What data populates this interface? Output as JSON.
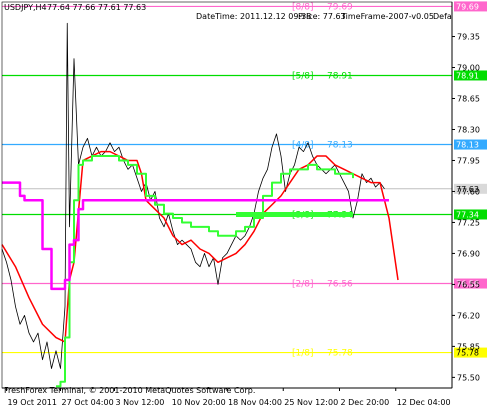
{
  "header": {
    "symbol": "USDJPY,H4",
    "ohlc": "77.64 77.66 77.61 77.63",
    "datetime": "DateTime: 2011.12.12 09:38",
    "price": "Price: 77.63",
    "timeframe": "TimeFrame-2007-v0.05",
    "defa": "Defa"
  },
  "footer": {
    "copyright": "FreshForex Terminal, © 2001-2010 MetaQuotes Software Corp."
  },
  "colors": {
    "background": "#ffffff",
    "axis": "#000000",
    "price_line": "#000000",
    "red_line": "#ff0000",
    "green_line": "#33ff33",
    "magenta_line": "#ff00ff",
    "level_pink": "#ff66cc",
    "level_green": "#00dd00",
    "level_blue": "#33aaff",
    "level_yellow": "#ffff00",
    "current_price": "#bfbfbf"
  },
  "chart_data": {
    "type": "line",
    "symbol": "USDJPY",
    "timeframe": "H4",
    "ylim": [
      75.38,
      79.74
    ],
    "xlim": [
      0,
      100
    ],
    "y_ticks": [
      "79.35",
      "79.00",
      "78.65",
      "78.30",
      "77.95",
      "77.60",
      "77.25",
      "76.90",
      "76.55",
      "76.20",
      "75.85",
      "75.50"
    ],
    "x_ticks": [
      {
        "label": "19 Oct 2011",
        "x": 1
      },
      {
        "label": "27 Oct 04:00",
        "x": 13
      },
      {
        "label": "3 Nov 12:00",
        "x": 25
      },
      {
        "label": "10 Nov 20:00",
        "x": 37.5
      },
      {
        "label": "18 Nov 04:00",
        "x": 50
      },
      {
        "label": "25 Nov 12:00",
        "x": 62.5
      },
      {
        "label": "2 Dec 20:00",
        "x": 75
      },
      {
        "label": "12 Dec 04:00",
        "x": 87.5
      }
    ],
    "levels": [
      {
        "name": "[8/8]",
        "label": "79.69",
        "value": 79.69,
        "tag": "79.69",
        "color": "#ff66cc"
      },
      {
        "name": "[5/8]",
        "label": "78.91",
        "value": 78.91,
        "tag": "78.91",
        "color": "#00dd00"
      },
      {
        "name": "[4/8]",
        "label": "78.13",
        "value": 78.13,
        "tag": "78.13",
        "color": "#33aaff"
      },
      {
        "name": "[3/8]",
        "label": "77.34",
        "value": 77.34,
        "tag": "77.34",
        "color": "#00dd00"
      },
      {
        "name": "[2/8]",
        "label": "76.56",
        "value": 76.56,
        "tag": "76.56",
        "color": "#ff66cc"
      },
      {
        "name": "[1/8]",
        "label": "75.78",
        "value": 75.78,
        "tag": "75.78",
        "color": "#ffff00"
      }
    ],
    "current_price": {
      "value": 77.63,
      "tag": "77.63"
    },
    "series": [
      {
        "name": "price",
        "x": [
          0,
          1,
          2,
          3,
          4,
          5,
          6,
          7,
          8,
          9,
          10,
          11,
          12,
          13,
          14,
          14.5,
          15,
          16,
          17,
          18,
          19,
          20,
          21,
          22,
          23,
          24,
          25,
          26,
          27,
          28,
          29,
          30,
          31,
          32,
          33,
          34,
          35,
          36,
          37,
          38,
          39,
          40,
          41,
          42,
          43,
          44,
          45,
          46,
          47,
          48,
          49,
          50,
          51,
          52,
          53,
          54,
          55,
          56,
          57,
          58,
          59,
          60,
          61,
          62,
          63,
          64,
          65,
          66,
          67,
          68,
          69,
          70,
          71,
          72,
          73,
          74,
          75,
          76,
          77,
          78,
          79,
          80,
          81,
          82,
          83,
          84,
          85
        ],
        "y": [
          76.95,
          76.8,
          76.6,
          76.3,
          76.1,
          76.2,
          76.0,
          75.9,
          76.0,
          75.7,
          75.9,
          75.6,
          75.8,
          75.6,
          76.3,
          79.5,
          77.2,
          79.1,
          77.9,
          78.1,
          78.2,
          78.0,
          78.1,
          78.0,
          78.05,
          78.15,
          78.05,
          78.1,
          77.95,
          77.85,
          77.9,
          77.75,
          77.6,
          77.7,
          77.5,
          77.6,
          77.3,
          77.2,
          77.35,
          77.15,
          77.0,
          77.05,
          77.0,
          76.95,
          76.8,
          76.75,
          76.9,
          76.75,
          76.85,
          76.55,
          76.85,
          76.9,
          77.0,
          77.1,
          77.05,
          77.1,
          77.2,
          77.35,
          77.6,
          77.75,
          77.85,
          78.1,
          78.25,
          78.0,
          77.6,
          77.8,
          77.9,
          78.1,
          78.05,
          78.15,
          78.0,
          77.9,
          77.85,
          77.8,
          77.85,
          77.9,
          77.8,
          77.7,
          77.6,
          77.3,
          77.5,
          77.8,
          77.7,
          77.75,
          77.65,
          77.7,
          77.63
        ]
      },
      {
        "name": "red",
        "x": [
          0,
          3,
          6,
          9,
          12,
          14,
          15,
          16,
          18,
          20,
          22,
          24,
          26,
          28,
          30,
          31,
          32,
          34,
          36,
          38,
          40,
          42,
          44,
          46,
          48,
          50,
          52,
          54,
          56,
          58,
          60,
          62,
          64,
          66,
          68,
          70,
          72,
          74,
          76,
          78,
          80,
          82,
          84,
          86,
          88
        ],
        "y": [
          77.0,
          76.75,
          76.4,
          76.1,
          75.95,
          75.9,
          76.6,
          76.8,
          77.95,
          78.0,
          78.05,
          78.05,
          78.0,
          77.95,
          77.95,
          77.8,
          77.5,
          77.4,
          77.3,
          77.1,
          77.0,
          77.05,
          76.95,
          76.9,
          76.8,
          76.85,
          76.9,
          77.0,
          77.15,
          77.35,
          77.45,
          77.55,
          77.7,
          77.85,
          77.9,
          78.0,
          78.0,
          77.9,
          77.85,
          77.8,
          77.75,
          77.7,
          77.7,
          77.3,
          76.6
        ]
      },
      {
        "name": "green",
        "x": [
          12,
          13,
          14,
          15,
          16,
          17,
          18,
          19,
          20,
          22,
          24,
          26,
          28,
          30,
          32,
          34,
          36,
          38,
          40,
          42,
          44,
          46,
          48,
          50,
          52,
          54,
          56,
          58,
          60,
          62,
          64,
          66,
          68,
          70,
          72,
          74,
          76,
          78
        ],
        "y": [
          75.4,
          75.45,
          75.95,
          76.8,
          77.5,
          77.9,
          77.95,
          77.95,
          78.0,
          78.0,
          78.0,
          77.95,
          77.9,
          77.8,
          77.55,
          77.45,
          77.35,
          77.3,
          77.25,
          77.2,
          77.2,
          77.15,
          77.1,
          77.1,
          77.15,
          77.2,
          77.3,
          77.55,
          77.7,
          77.8,
          77.85,
          77.85,
          77.9,
          77.85,
          77.85,
          77.8,
          77.8,
          77.75
        ]
      },
      {
        "name": "magenta",
        "x": [
          0,
          3,
          4,
          5,
          7,
          9,
          10,
          11,
          12,
          13,
          14,
          15,
          16,
          17,
          18,
          20,
          22,
          24,
          25,
          26,
          28,
          30,
          32,
          34,
          36,
          38,
          40,
          42,
          44,
          46,
          48,
          50,
          52,
          54,
          56,
          58,
          60,
          62,
          64,
          66,
          68,
          70,
          72,
          74,
          76,
          78,
          80,
          82,
          84,
          86
        ],
        "y": [
          77.7,
          77.7,
          77.55,
          77.5,
          77.5,
          76.95,
          76.95,
          76.5,
          76.5,
          76.5,
          76.6,
          77.0,
          77.05,
          77.4,
          77.5,
          77.5,
          77.5,
          77.5,
          77.5,
          77.5,
          77.5,
          77.5,
          77.5,
          77.5,
          77.5,
          77.5,
          77.5,
          77.5,
          77.5,
          77.5,
          77.5,
          77.5,
          77.5,
          77.5,
          77.5,
          77.5,
          77.5,
          77.5,
          77.5,
          77.5,
          77.5,
          77.5,
          77.5,
          77.5,
          77.5,
          77.5,
          77.5,
          77.5,
          77.5,
          77.5
        ]
      }
    ],
    "markers": [
      {
        "name": "green-band",
        "x0": 52,
        "x1": 78,
        "y": 77.34
      }
    ]
  }
}
